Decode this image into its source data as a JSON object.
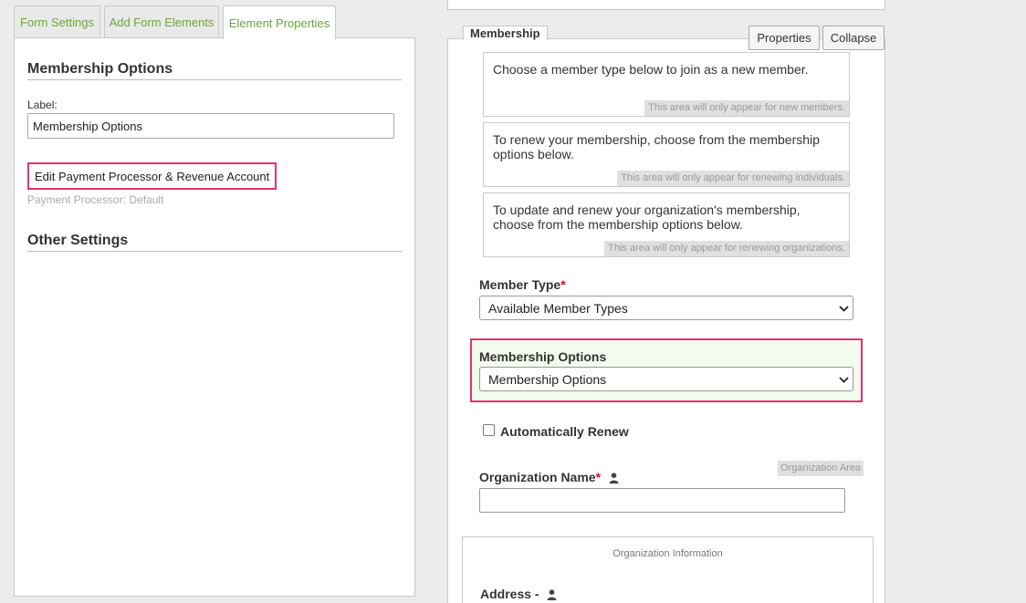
{
  "tabs": [
    {
      "label": "Form Settings"
    },
    {
      "label": "Add Form Elements"
    },
    {
      "label": "Element Properties"
    }
  ],
  "editor": {
    "section_title": "Membership Options",
    "label_caption": "Label:",
    "label_value": "Membership Options",
    "processor_button": "Edit Payment Processor & Revenue Account",
    "processor_note": "Payment Processor: Default",
    "other_settings_title": "Other Settings"
  },
  "preview": {
    "tab_label": "Membership",
    "properties_button": "Properties",
    "collapse_button": "Collapse",
    "messages": [
      {
        "text": "Choose a member type below to join as a new member.",
        "note": "This area will only appear for new members."
      },
      {
        "text": "To renew your membership, choose from the membership options below.",
        "note": "This area will only appear for renewing individuals."
      },
      {
        "text": "To update and renew your organization's membership, choose from the membership options below.",
        "note": "This area will only appear for renewing organizations."
      }
    ],
    "member_type": {
      "label": "Member Type",
      "required": "*",
      "selected": "Available Member Types"
    },
    "membership_options": {
      "label": "Membership Options",
      "selected": "Membership Options"
    },
    "auto_renew": {
      "label": "Automatically Renew",
      "checked": false
    },
    "organization_area_tag": "Organization Area",
    "organization_name": {
      "label": "Organization Name",
      "required": "*",
      "value": ""
    },
    "organization_info_title": "Organization Information",
    "address": {
      "label": "Address -"
    }
  },
  "colors": {
    "tab_text": "#6aa53a",
    "highlight": "#e2336c",
    "required": "#c8102e",
    "highlight_bg": "#f3fbec"
  },
  "icons": {
    "chevron": "chevron-down-icon",
    "person": "person-icon"
  }
}
